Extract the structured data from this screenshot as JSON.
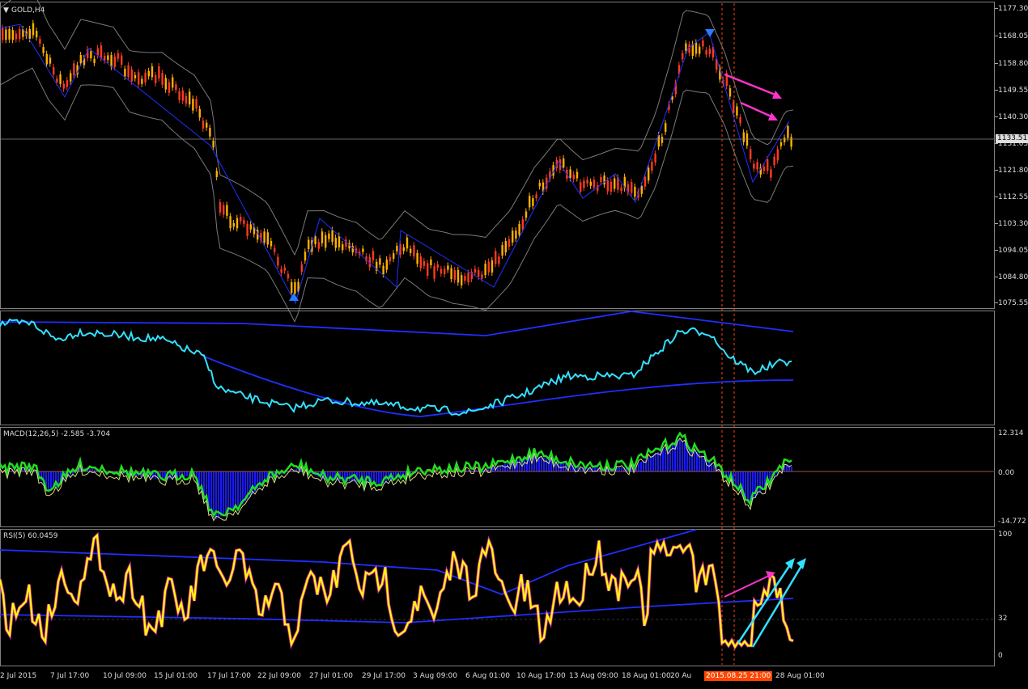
{
  "main": {
    "symbol_label": "GOLD,H4",
    "current_price": "1133.51",
    "price_ticks": [
      "1177.30",
      "1168.05",
      "1158.80",
      "1149.55",
      "1140.30",
      "1131.05",
      "1121.80",
      "1112.55",
      "1103.30",
      "1094.05",
      "1084.80",
      "1075.55"
    ]
  },
  "macd": {
    "label": "MACD(12,26,5) -2.585 -3.704",
    "ticks": [
      "12.314",
      "0.00",
      "-14.772"
    ]
  },
  "rsi": {
    "label": "RSI(5) 60.0459",
    "ticks": [
      "100",
      "32",
      "0"
    ]
  },
  "time_axis": {
    "dates": [
      "2 Jul 2015",
      "7 Jul 17:00",
      "10 Jul 09:00",
      "15 Jul 01:00",
      "17 Jul 17:00",
      "22 Jul 09:00",
      "27 Jul 01:00",
      "29 Jul 17:00",
      "3 Aug 09:00",
      "6 Aug 01:00",
      "10 Aug 17:00",
      "13 Aug 09:00",
      "18 Aug 01:00",
      "20 Au",
      "28 Aug 01:00"
    ],
    "crosshair_date": "2015.08.25 21:00"
  },
  "colors": {
    "bull": "#ffb000",
    "bear": "#ff3b1f",
    "band": "#7a7a7a",
    "trend": "#1f2fff",
    "cyan": "#33e0ff",
    "lime": "#22dd22",
    "yellow": "#ffff00",
    "magenta": "#ff33cc",
    "arrow_blue": "#2a7bff"
  }
}
